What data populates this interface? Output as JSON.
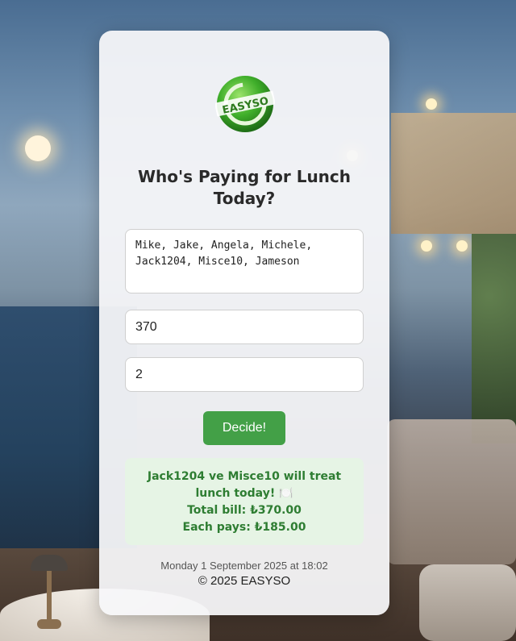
{
  "app": {
    "brand": "EASYSO",
    "title": "Who's Paying for Lunch Today?"
  },
  "form": {
    "names_value": "Mike, Jake, Angela, Michele, Jack1204, Misce10, Jameson",
    "bill_value": "370",
    "payers_value": "2",
    "decide_label": "Decide!"
  },
  "result": {
    "line1": "Jack1204 ve Misce10 will treat lunch today! 🍽️",
    "line2": "Total bill: ₺370.00",
    "line3": "Each pays: ₺185.00"
  },
  "footer": {
    "datetime": "Monday 1 September 2025 at 18:02",
    "copyright": "© 2025 EASYSO"
  },
  "colors": {
    "accent": "#43a047",
    "result_bg": "#e6f4e5",
    "result_text": "#2e7d32"
  },
  "icons": {
    "logo": "easyso-logo"
  }
}
